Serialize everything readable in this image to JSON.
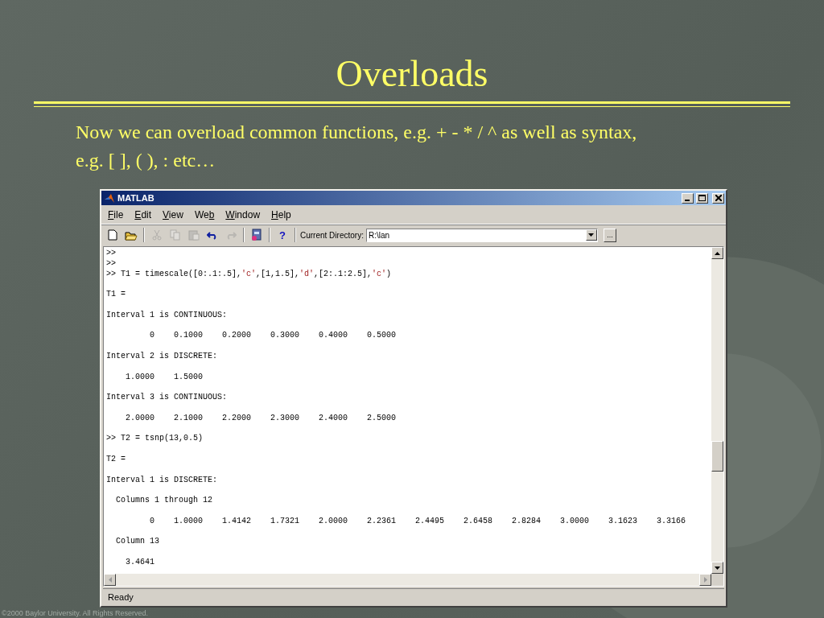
{
  "slide": {
    "title": "Overloads",
    "body": "Now we can overload common functions, e.g. + - * / ^ as well as syntax, e.g. [ ], ( ), : etc…",
    "footer": "©2000 Baylor University. All Rights Reserved."
  },
  "window": {
    "title": "MATLAB",
    "menu": [
      {
        "access_key": "F",
        "after": "ile"
      },
      {
        "access_key": "E",
        "after": "dit"
      },
      {
        "access_key": "V",
        "after": "iew"
      },
      {
        "before": "We",
        "access_key": "b"
      },
      {
        "access_key": "W",
        "after": "indow"
      },
      {
        "access_key": "H",
        "after": "elp"
      }
    ],
    "toolbar": [
      {
        "kind": "new",
        "disabled": false
      },
      {
        "kind": "open",
        "disabled": false
      },
      {
        "kind": "sep"
      },
      {
        "kind": "cut",
        "disabled": true
      },
      {
        "kind": "copy",
        "disabled": true
      },
      {
        "kind": "paste",
        "disabled": true
      },
      {
        "kind": "undo",
        "disabled": false
      },
      {
        "kind": "redo",
        "disabled": true
      },
      {
        "kind": "sep"
      },
      {
        "kind": "simulink",
        "disabled": false
      },
      {
        "kind": "sep"
      },
      {
        "kind": "help",
        "glyph": "?",
        "disabled": false
      },
      {
        "kind": "sep"
      }
    ],
    "directory": {
      "label": "Current Directory:",
      "value": "R:\\lan",
      "browse_label": "..."
    },
    "console": [
      [
        {
          "kind": "code",
          "parts": [
            {
              "kind": "plain",
              "text": ">>"
            }
          ]
        },
        {
          "kind": "code",
          "parts": [
            {
              "kind": "plain",
              "text": ">>"
            }
          ]
        },
        {
          "kind": "code",
          "parts": [
            {
              "kind": "plain",
              "text": ">> T1 = timescale([0:.1:.5],"
            },
            {
              "kind": "string",
              "text": "'c'"
            },
            {
              "kind": "plain",
              "text": ",[1,1.5],"
            },
            {
              "kind": "string",
              "text": "'d'"
            },
            {
              "kind": "plain",
              "text": ",[2:.1:2.5],"
            },
            {
              "kind": "string",
              "text": "'c'"
            },
            {
              "kind": "plain",
              "text": ")"
            }
          ]
        }
      ],
      [
        {
          "kind": "text",
          "text": "T1 ="
        }
      ],
      [
        {
          "kind": "text",
          "text": "Interval 1 is CONTINUOUS:"
        }
      ],
      [
        {
          "kind": "values",
          "values": [
            "0",
            "0.1000",
            "0.2000",
            "0.3000",
            "0.4000",
            "0.5000"
          ]
        }
      ],
      [
        {
          "kind": "text",
          "text": "Interval 2 is DISCRETE:"
        }
      ],
      [
        {
          "kind": "values",
          "values": [
            "1.0000",
            "1.5000"
          ]
        }
      ],
      [
        {
          "kind": "text",
          "text": "Interval 3 is CONTINUOUS:"
        }
      ],
      [
        {
          "kind": "values",
          "values": [
            "2.0000",
            "2.1000",
            "2.2000",
            "2.3000",
            "2.4000",
            "2.5000"
          ]
        }
      ],
      [
        {
          "kind": "code",
          "parts": [
            {
              "kind": "plain",
              "text": ">> T2 = tsnp(13,0.5)"
            }
          ]
        }
      ],
      [
        {
          "kind": "text",
          "text": "T2 ="
        }
      ],
      [
        {
          "kind": "text",
          "text": "Interval 1 is DISCRETE:"
        }
      ],
      [
        {
          "kind": "text",
          "text": "  Columns 1 through 12"
        }
      ],
      [
        {
          "kind": "values",
          "values": [
            "0",
            "1.0000",
            "1.4142",
            "1.7321",
            "2.0000",
            "2.2361",
            "2.4495",
            "2.6458",
            "2.8284",
            "3.0000",
            "3.1623",
            "3.3166"
          ]
        }
      ],
      [
        {
          "kind": "text",
          "text": "  Column 13"
        }
      ],
      [
        {
          "kind": "values",
          "values": [
            "3.4641"
          ]
        }
      ]
    ],
    "status": "Ready"
  }
}
